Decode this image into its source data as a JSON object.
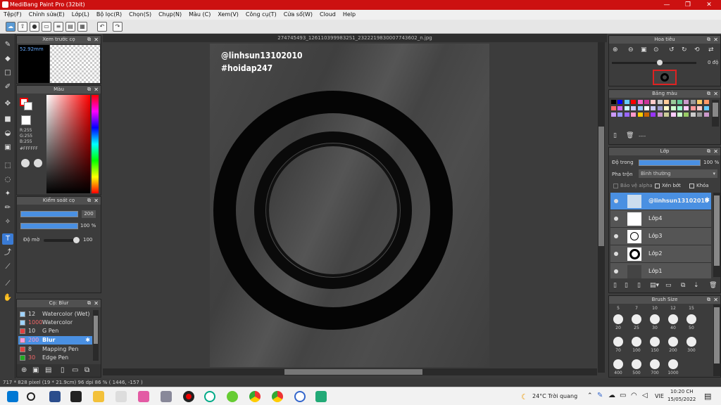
{
  "app": {
    "title": "MediBang Paint Pro (32bit)"
  },
  "menu": [
    "Tệp(F)",
    "Chỉnh sửa(E)",
    "Lớp(L)",
    "Bộ lọc(R)",
    "Chọn(S)",
    "Chụp(N)",
    "Màu (C)",
    "Xem(V)",
    "Công cụ(T)",
    "Cửa sổ(W)",
    "Cloud",
    "Help"
  ],
  "document": {
    "tab_title": "274745493_1261103999832S1_2322219830007743602_n.jpg",
    "watermark1": "@linhsun13102010",
    "watermark2": "#hoidap247"
  },
  "preview": {
    "title": "Xem trước cọ",
    "size": "52.92mm"
  },
  "color": {
    "title": "Màu",
    "r": "R:255",
    "g": "G:255",
    "b": "B:255",
    "hex": "#FFFFFF"
  },
  "brush_control": {
    "title": "Kiểm soát cọ",
    "size": "200",
    "opacity": "100 %",
    "blur_label": "Độ mờ",
    "blur": "100"
  },
  "brush_list": {
    "title": "Cọ: Blur",
    "items": [
      {
        "num": "12",
        "name": "Watercolor (Wet)",
        "color": "#9fd3ff"
      },
      {
        "num": "1000",
        "name": "Watercolor",
        "color": "#9fd3ff"
      },
      {
        "num": "10",
        "name": "G Pen",
        "color": "#e04040"
      },
      {
        "num": "200",
        "name": "Blur",
        "color": "#ff99dd"
      },
      {
        "num": "8",
        "name": "Mapping Pen",
        "color": "#e04040"
      },
      {
        "num": "30",
        "name": "Edge Pen",
        "color": "#22aa22"
      }
    ]
  },
  "navigator": {
    "title": "Hoa tiêu",
    "angle": "0 độ"
  },
  "palette": {
    "title": "Bảng màu",
    "footer": "----"
  },
  "layers": {
    "title": "Lớp",
    "opacity_label": "Độ trong",
    "opacity": "100 %",
    "blend_label": "Pha trộn",
    "blend": "Bình thường",
    "protect_alpha": "Bảo vệ alpha",
    "clip": "Xén bớt",
    "lock": "Khóa",
    "items": [
      {
        "name": "@linhsun13102010"
      },
      {
        "name": "Lớp4"
      },
      {
        "name": "Lớp3"
      },
      {
        "name": "Lớp2"
      },
      {
        "name": "Lớp1"
      }
    ]
  },
  "brush_size": {
    "title": "Brush Size",
    "top": [
      "5",
      "7",
      "10",
      "12",
      "15"
    ],
    "row1": [
      "20",
      "25",
      "30",
      "40",
      "50"
    ],
    "row2": [
      "70",
      "100",
      "150",
      "200",
      "300"
    ],
    "row3": [
      "400",
      "500",
      "700",
      "1000"
    ]
  },
  "status": "717 * 828 pixel   (19 * 21.9cm)   96 dpi   86 %   ( 1446, -157 )",
  "taskbar": {
    "weather": "24°C  Trời quang",
    "lang": "VIE",
    "time": "10:20 CH",
    "date": "15/05/2022"
  }
}
